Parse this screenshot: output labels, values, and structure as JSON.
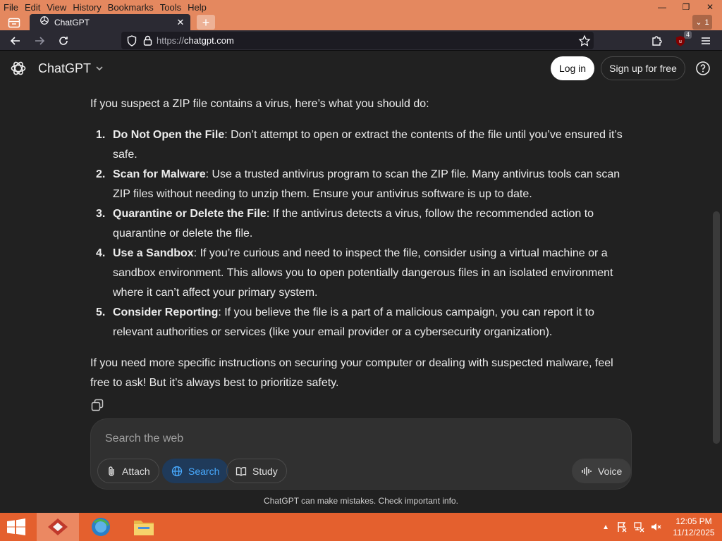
{
  "browser": {
    "menu": [
      "File",
      "Edit",
      "View",
      "History",
      "Bookmarks",
      "Tools",
      "Help"
    ],
    "tab_title": "ChatGPT",
    "tab_count": "1",
    "url_protocol": "https://",
    "url_host": "chatgpt.com",
    "ublock_count": "4"
  },
  "header": {
    "model_label": "ChatGPT",
    "login_label": "Log in",
    "signup_label": "Sign up for free"
  },
  "message": {
    "intro": "If you suspect a ZIP file contains a virus, here’s what you should do:",
    "items": [
      {
        "num": "1.",
        "title": "Do Not Open the File",
        "text": ": Don’t attempt to open or extract the contents of the file until you’ve ensured it’s safe."
      },
      {
        "num": "2.",
        "title": "Scan for Malware",
        "text": ": Use a trusted antivirus program to scan the ZIP file. Many antivirus tools can scan ZIP files without needing to unzip them. Ensure your antivirus software is up to date."
      },
      {
        "num": "3.",
        "title": "Quarantine or Delete the File",
        "text": ": If the antivirus detects a virus, follow the recommended action to quarantine or delete the file."
      },
      {
        "num": "4.",
        "title": "Use a Sandbox",
        "text": ": If you’re curious and need to inspect the file, consider using a virtual machine or a sandbox environment. This allows you to open potentially dangerous files in an isolated environment where it can’t affect your primary system."
      },
      {
        "num": "5.",
        "title": "Consider Reporting",
        "text": ": If you believe the file is a part of a malicious campaign, you can report it to relevant authorities or services (like your email provider or a cybersecurity organization)."
      }
    ],
    "outro": "If you need more specific instructions on securing your computer or dealing with suspected malware, feel free to ask! But it’s always best to prioritize safety."
  },
  "composer": {
    "placeholder": "Search the web",
    "attach_label": "Attach",
    "search_label": "Search",
    "study_label": "Study",
    "voice_label": "Voice"
  },
  "disclaimer": "ChatGPT can make mistakes. Check important info.",
  "taskbar": {
    "time": "12:05 PM",
    "date": "11/12/2025"
  },
  "colors": {
    "browser_chrome": "#e4885f",
    "taskbar": "#e4602e",
    "page_bg": "#212121",
    "search_active": "#48aaff"
  },
  "icons": [
    "tab-list-icon",
    "chatgpt-logo-icon",
    "close-icon",
    "plus-icon",
    "back-icon",
    "forward-icon",
    "reload-icon",
    "shield-icon",
    "lock-icon",
    "star-icon",
    "extensions-icon",
    "ublock-icon",
    "menu-icon",
    "chevron-down-icon",
    "help-icon",
    "copy-icon",
    "paperclip-icon",
    "globe-icon",
    "book-icon",
    "waveform-icon",
    "windows-start-icon",
    "flag-icon",
    "network-icon",
    "speaker-mute-icon"
  ]
}
